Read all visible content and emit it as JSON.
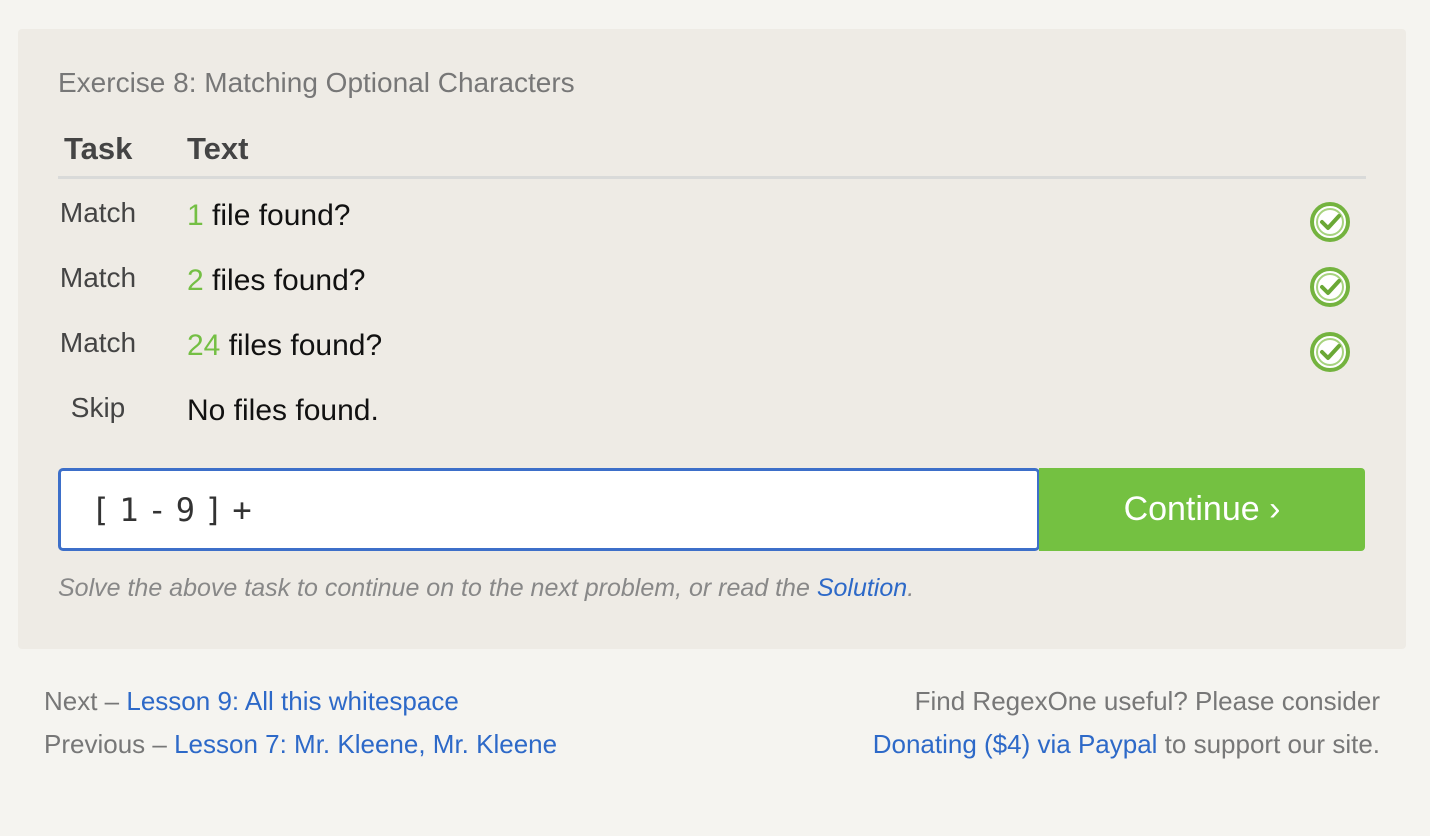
{
  "exercise": {
    "title": "Exercise 8: Matching Optional Characters",
    "headers": {
      "task": "Task",
      "text": "Text"
    },
    "rows": [
      {
        "task": "Match",
        "highlight": "1",
        "rest": " file found?",
        "status": "check-icon"
      },
      {
        "task": "Match",
        "highlight": "2",
        "rest": " files found?",
        "status": "check-icon"
      },
      {
        "task": "Match",
        "highlight": "24",
        "rest": " files found?",
        "status": "check-icon"
      },
      {
        "task": "Skip",
        "highlight": "",
        "rest": "No files found.",
        "status": ""
      }
    ],
    "input_value": "[1-9]+",
    "continue_label": "Continue ›",
    "hint_prefix": "Solve the above task to continue on to the next problem, or read the ",
    "hint_link": "Solution",
    "hint_suffix": "."
  },
  "footer": {
    "next_prefix": "Next – ",
    "next_link": "Lesson 9: All this whitespace",
    "previous_prefix": "Previous – ",
    "previous_link": "Lesson 7: Mr. Kleene, Mr. Kleene",
    "donate_line1": "Find RegexOne useful? Please consider",
    "donate_link": "Donating ($4) via Paypal",
    "donate_suffix": " to support our site."
  },
  "colors": {
    "accent_green": "#74c141",
    "link_blue": "#2d69c8",
    "input_border": "#3d6fc9"
  }
}
